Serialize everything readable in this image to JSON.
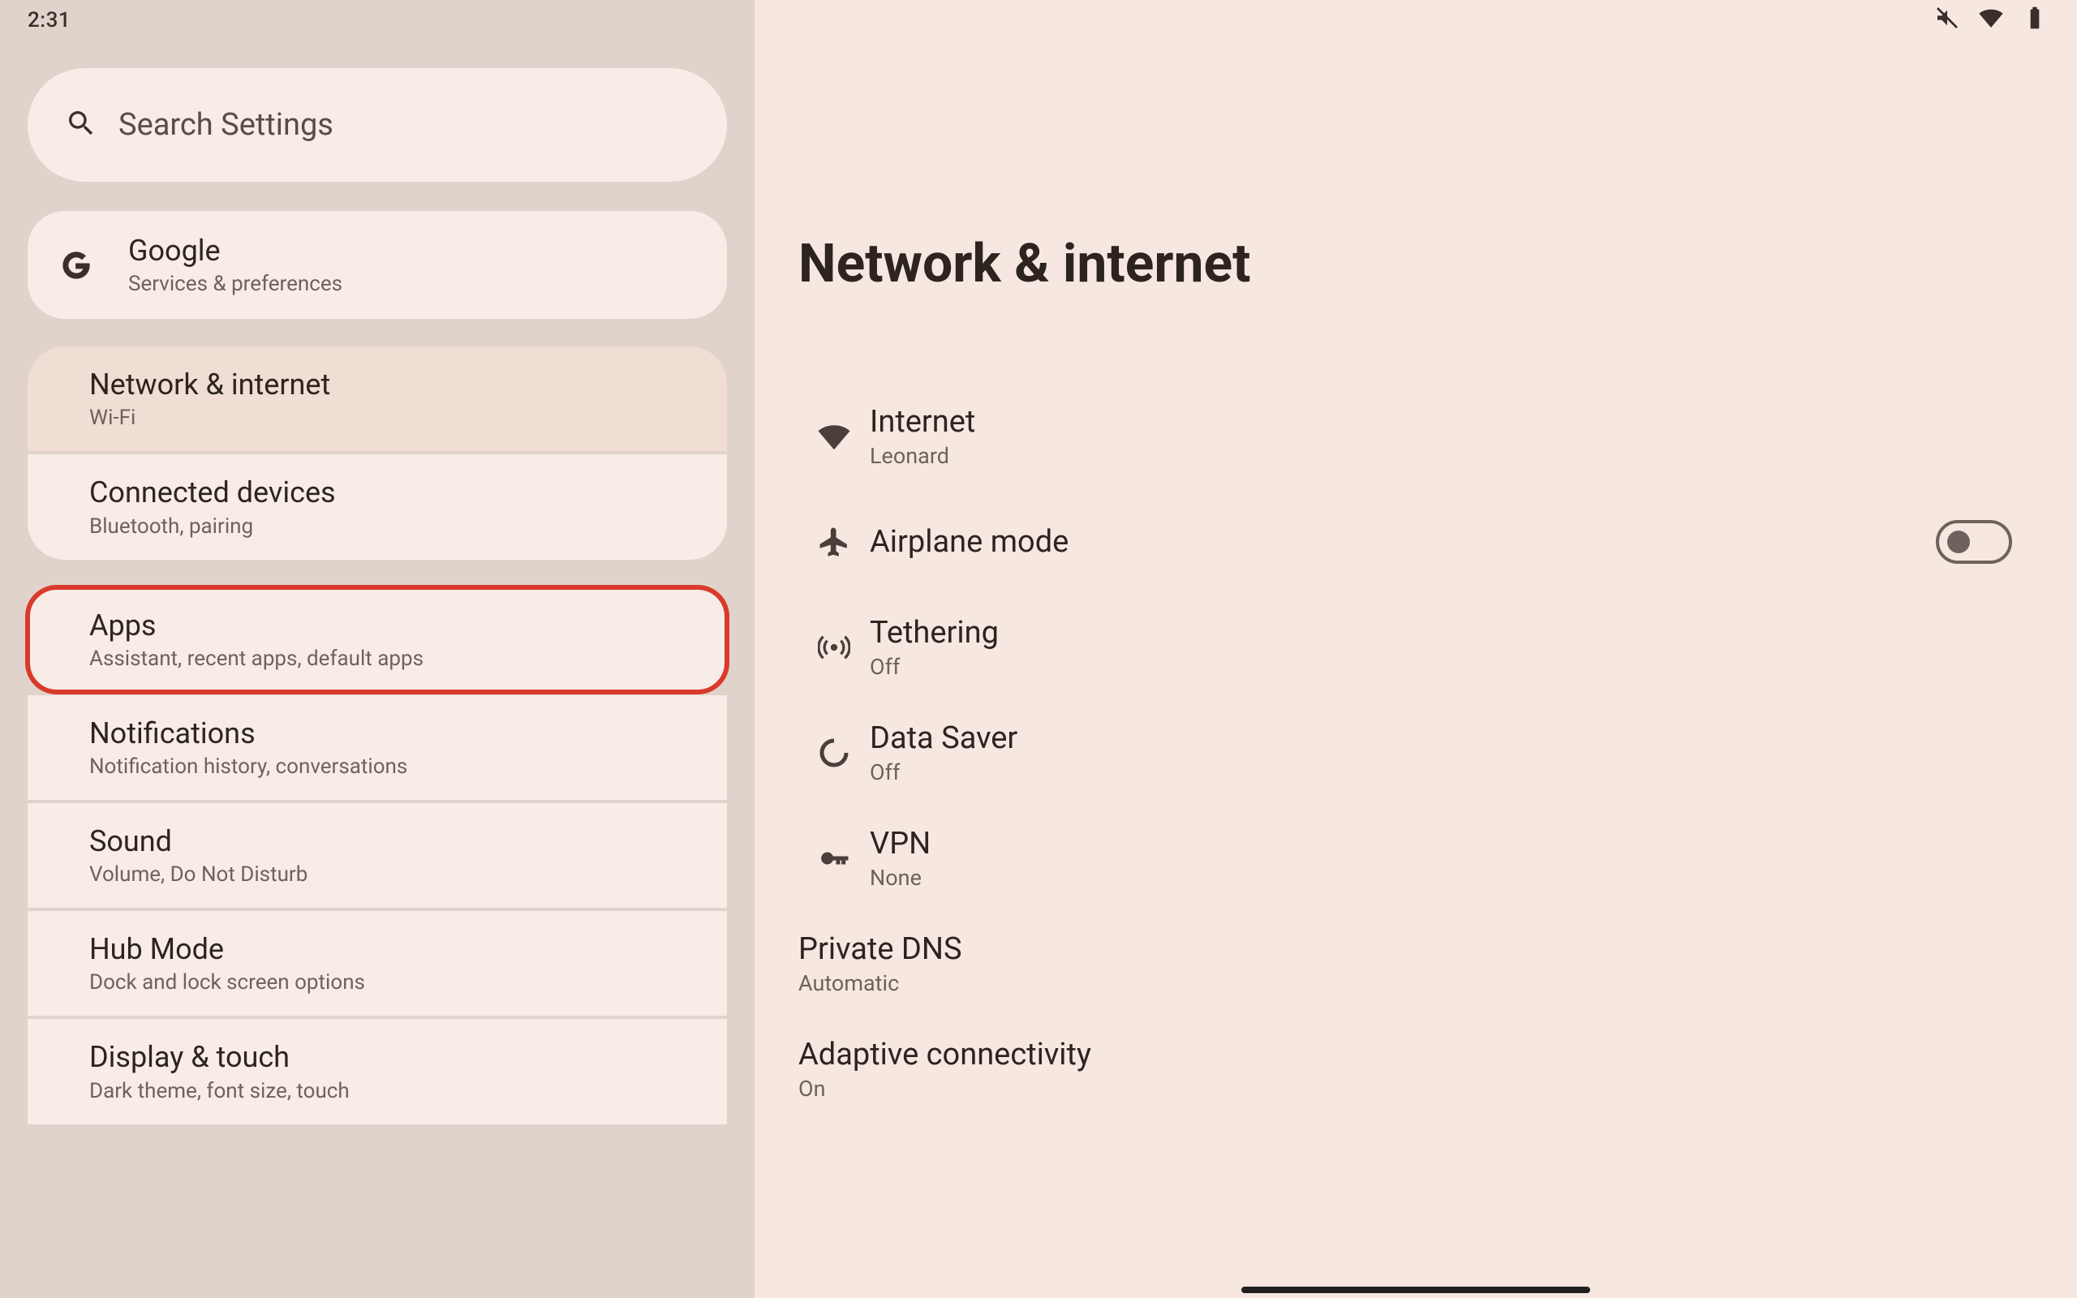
{
  "status": {
    "time": "2:31",
    "icons": [
      "mute-icon",
      "wifi-icon",
      "battery-icon"
    ]
  },
  "search": {
    "placeholder": "Search Settings"
  },
  "sidebar": {
    "google": {
      "title": "Google",
      "sub": "Services & preferences"
    },
    "groups": [
      [
        {
          "id": "network",
          "title": "Network & internet",
          "sub": "Wi-Fi",
          "selected": true
        },
        {
          "id": "devices",
          "title": "Connected devices",
          "sub": "Bluetooth, pairing"
        }
      ],
      [
        {
          "id": "apps",
          "title": "Apps",
          "sub": "Assistant, recent apps, default apps",
          "highlighted": true
        },
        {
          "id": "notif",
          "title": "Notifications",
          "sub": "Notification history, conversations"
        },
        {
          "id": "sound",
          "title": "Sound",
          "sub": "Volume, Do Not Disturb"
        },
        {
          "id": "hub",
          "title": "Hub Mode",
          "sub": "Dock and lock screen options"
        },
        {
          "id": "display",
          "title": "Display & touch",
          "sub": "Dark theme, font size, touch"
        }
      ]
    ]
  },
  "page": {
    "title": "Network & internet",
    "items": [
      {
        "id": "internet",
        "title": "Internet",
        "sub": "Leonard",
        "icon": "wifi-full-icon"
      },
      {
        "id": "airplane",
        "title": "Airplane mode",
        "sub": null,
        "icon": "airplane-icon",
        "toggle": false
      },
      {
        "id": "tether",
        "title": "Tethering",
        "sub": "Off",
        "icon": "hotspot-icon"
      },
      {
        "id": "datasaver",
        "title": "Data Saver",
        "sub": "Off",
        "icon": "datasaver-icon"
      },
      {
        "id": "vpn",
        "title": "VPN",
        "sub": "None",
        "icon": "vpn-key-icon"
      },
      {
        "id": "pdns",
        "title": "Private DNS",
        "sub": "Automatic",
        "icon": null
      },
      {
        "id": "adaptive",
        "title": "Adaptive connectivity",
        "sub": "On",
        "icon": null
      }
    ]
  }
}
